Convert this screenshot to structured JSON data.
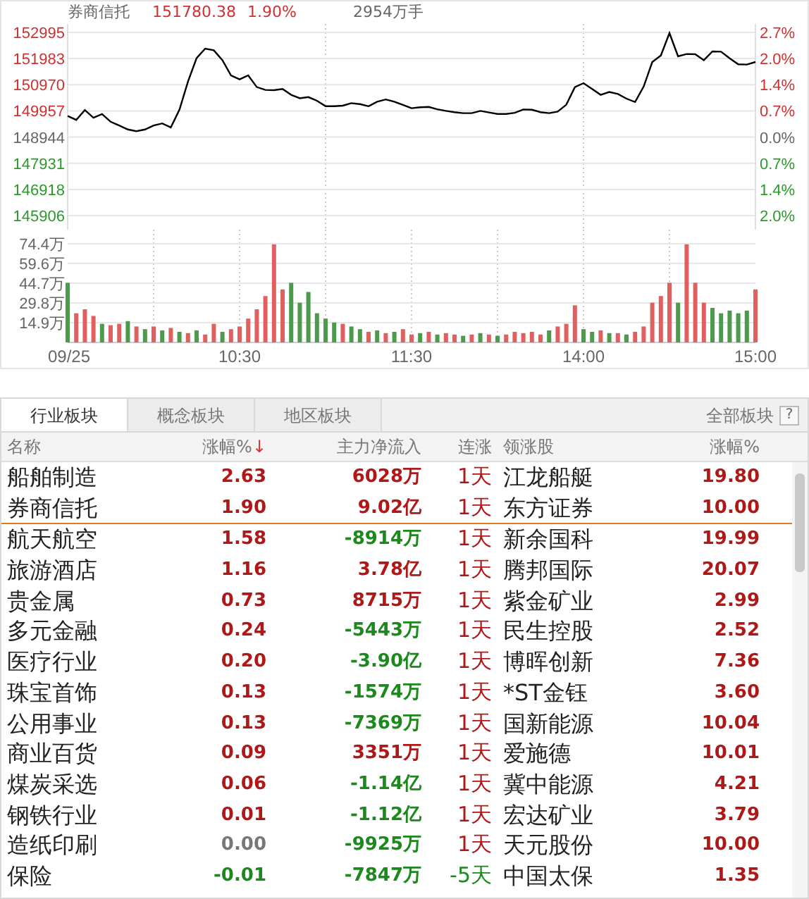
{
  "quote": {
    "name": "券商信托",
    "price": "151780.38",
    "change": "1.90%",
    "volume": "2954万手"
  },
  "price_chart": {
    "right_labels": [
      {
        "label": "2.7%",
        "color": "#d03030"
      },
      {
        "label": "2.0%",
        "color": "#d03030"
      },
      {
        "label": "1.4%",
        "color": "#d03030"
      },
      {
        "label": "0.7%",
        "color": "#d03030"
      },
      {
        "label": "0.0%",
        "color": "#666666"
      },
      {
        "label": "0.7%",
        "color": "#2a9a2a"
      },
      {
        "label": "1.4%",
        "color": "#2a9a2a"
      },
      {
        "label": "2.0%",
        "color": "#2a9a2a"
      }
    ],
    "chart_data": {
      "type": "line",
      "grid": true,
      "ylim": [
        145906,
        152995
      ],
      "yticks": [
        152995,
        151983,
        150970,
        149957,
        148944,
        147931,
        146918,
        145906
      ],
      "categories": [
        null,
        null,
        null,
        null,
        null,
        null,
        null,
        null,
        null,
        null,
        null,
        null,
        null,
        null,
        null,
        null,
        null,
        null,
        null,
        null,
        null,
        null,
        null,
        null,
        null,
        null,
        null,
        null,
        null,
        null,
        null,
        null,
        null,
        null,
        null,
        null,
        null,
        null,
        null,
        null,
        null,
        null,
        null,
        null,
        null,
        null,
        null,
        null,
        null,
        null,
        null,
        null,
        null,
        null,
        null,
        null,
        null,
        null,
        null,
        null,
        null,
        null,
        null,
        null,
        null,
        null,
        null,
        null,
        null,
        null,
        null,
        null,
        null,
        null,
        null,
        null,
        null,
        null,
        null,
        null,
        null
      ],
      "series": [
        {
          "color": "#000000",
          "values": [
            149760,
            149610,
            149990,
            149690,
            149840,
            149540,
            149390,
            149240,
            149170,
            149240,
            149390,
            149470,
            149320,
            150000,
            151100,
            152000,
            152370,
            152300,
            151920,
            151330,
            151180,
            151330,
            150880,
            150770,
            150760,
            150810,
            150580,
            150450,
            150490,
            150350,
            150140,
            150140,
            150160,
            150260,
            150220,
            150140,
            150310,
            150400,
            150310,
            150190,
            150060,
            150100,
            150110,
            150020,
            149960,
            149910,
            149870,
            149870,
            149960,
            149900,
            149840,
            149840,
            149880,
            150010,
            150000,
            149910,
            149870,
            149930,
            150200,
            150880,
            151030,
            150810,
            150580,
            150690,
            150610,
            150430,
            150300,
            150900,
            151850,
            152100,
            152970,
            152070,
            152160,
            152150,
            151920,
            152260,
            152250,
            151990,
            151760,
            151750,
            151850
          ]
        }
      ]
    }
  },
  "volume_chart": {
    "chart_data": {
      "type": "bar",
      "grid": true,
      "ylim": [
        0,
        74.4
      ],
      "yticks": [
        {
          "value": 74.4,
          "label": "74.4万"
        },
        {
          "value": 59.6,
          "label": "59.6万"
        },
        {
          "value": 44.7,
          "label": "44.7万"
        },
        {
          "value": 29.8,
          "label": "29.8万"
        },
        {
          "value": 14.9,
          "label": "14.9万"
        }
      ],
      "categories": [
        "09/25",
        null,
        null,
        null,
        null,
        null,
        null,
        null,
        null,
        null,
        null,
        null,
        null,
        null,
        null,
        null,
        null,
        null,
        null,
        null,
        "10:30",
        null,
        null,
        null,
        null,
        null,
        null,
        null,
        null,
        null,
        null,
        null,
        null,
        null,
        null,
        null,
        null,
        null,
        null,
        null,
        "11:30",
        null,
        null,
        null,
        null,
        null,
        null,
        null,
        null,
        null,
        null,
        null,
        null,
        null,
        null,
        null,
        null,
        null,
        null,
        null,
        "14:00",
        null,
        null,
        null,
        null,
        null,
        null,
        null,
        null,
        null,
        null,
        null,
        null,
        null,
        null,
        null,
        null,
        null,
        null,
        null,
        "15:00"
      ],
      "series": [
        {
          "color": "#e06060",
          "values": [
            null,
            22,
            25,
            20,
            null,
            13,
            14,
            null,
            12,
            null,
            12,
            null,
            11,
            null,
            7,
            null,
            6,
            14,
            null,
            10,
            12,
            18,
            25,
            35,
            74,
            40,
            null,
            null,
            null,
            null,
            null,
            null,
            14,
            null,
            null,
            8,
            null,
            7,
            null,
            10,
            6,
            null,
            8,
            null,
            7,
            6,
            null,
            6,
            null,
            6,
            null,
            6,
            8,
            7,
            8,
            6,
            null,
            12,
            14,
            28,
            null,
            null,
            9,
            null,
            7,
            null,
            8,
            12,
            30,
            35,
            45,
            null,
            74,
            45,
            30,
            null,
            null,
            null,
            null,
            null,
            40
          ]
        },
        {
          "color": "#4c9a4c",
          "values": [
            45,
            null,
            null,
            null,
            14,
            null,
            null,
            16,
            null,
            10,
            null,
            9,
            null,
            8,
            null,
            9,
            null,
            null,
            8,
            null,
            null,
            null,
            null,
            null,
            null,
            null,
            45,
            30,
            38,
            22,
            18,
            15,
            null,
            12,
            10,
            null,
            9,
            null,
            8,
            null,
            null,
            7,
            null,
            6,
            null,
            null,
            5,
            null,
            7,
            null,
            5,
            null,
            null,
            null,
            null,
            null,
            9,
            null,
            null,
            null,
            10,
            8,
            null,
            7,
            null,
            6,
            null,
            null,
            null,
            null,
            null,
            30,
            null,
            null,
            null,
            26,
            22,
            24,
            22,
            24,
            null
          ]
        }
      ]
    }
  },
  "tabs": [
    {
      "label": "行业板块",
      "selected": true
    },
    {
      "label": "概念板块",
      "selected": false
    },
    {
      "label": "地区板块",
      "selected": false
    }
  ],
  "all_sectors": {
    "label": "全部板块",
    "help": "?"
  },
  "columns": [
    {
      "label": "名称"
    },
    {
      "label": "涨幅%",
      "sort_mark": "↓"
    },
    {
      "label": "主力净流入"
    },
    {
      "label": "连涨"
    },
    {
      "label": "领涨股"
    },
    {
      "label": "涨幅%"
    }
  ],
  "rows": [
    {
      "name": "船舶制造",
      "change": {
        "text": "2.63",
        "color": "#b01818"
      },
      "flow": {
        "text": "6028万",
        "color": "#b01818"
      },
      "streak": {
        "text": "1天",
        "color": "#b01818"
      },
      "leader": "江龙船艇",
      "leader_change": "19.80",
      "pinned": true
    },
    {
      "name": "券商信托",
      "change": {
        "text": "1.90",
        "color": "#b01818"
      },
      "flow": {
        "text": "9.02亿",
        "color": "#b01818"
      },
      "streak": {
        "text": "1天",
        "color": "#b01818"
      },
      "leader": "东方证券",
      "leader_change": "10.00",
      "pinned": true
    },
    {
      "name": "航天航空",
      "change": {
        "text": "1.58",
        "color": "#b01818"
      },
      "flow": {
        "text": "-8914万",
        "color": "#1a8a1a"
      },
      "streak": {
        "text": "1天",
        "color": "#b01818"
      },
      "leader": "新余国科",
      "leader_change": "19.99",
      "pinned": false
    },
    {
      "name": "旅游酒店",
      "change": {
        "text": "1.16",
        "color": "#b01818"
      },
      "flow": {
        "text": "3.78亿",
        "color": "#b01818"
      },
      "streak": {
        "text": "1天",
        "color": "#b01818"
      },
      "leader": "腾邦国际",
      "leader_change": "20.07",
      "pinned": false
    },
    {
      "name": "贵金属",
      "change": {
        "text": "0.73",
        "color": "#b01818"
      },
      "flow": {
        "text": "8715万",
        "color": "#b01818"
      },
      "streak": {
        "text": "1天",
        "color": "#b01818"
      },
      "leader": "紫金矿业",
      "leader_change": "2.99",
      "pinned": false
    },
    {
      "name": "多元金融",
      "change": {
        "text": "0.24",
        "color": "#b01818"
      },
      "flow": {
        "text": "-5443万",
        "color": "#1a8a1a"
      },
      "streak": {
        "text": "1天",
        "color": "#b01818"
      },
      "leader": "民生控股",
      "leader_change": "2.52",
      "pinned": false
    },
    {
      "name": "医疗行业",
      "change": {
        "text": "0.20",
        "color": "#b01818"
      },
      "flow": {
        "text": "-3.90亿",
        "color": "#1a8a1a"
      },
      "streak": {
        "text": "1天",
        "color": "#b01818"
      },
      "leader": "博晖创新",
      "leader_change": "7.36",
      "pinned": false
    },
    {
      "name": "珠宝首饰",
      "change": {
        "text": "0.13",
        "color": "#b01818"
      },
      "flow": {
        "text": "-1574万",
        "color": "#1a8a1a"
      },
      "streak": {
        "text": "1天",
        "color": "#b01818"
      },
      "leader": "*ST金钰",
      "leader_change": "3.60",
      "pinned": false
    },
    {
      "name": "公用事业",
      "change": {
        "text": "0.13",
        "color": "#b01818"
      },
      "flow": {
        "text": "-7369万",
        "color": "#1a8a1a"
      },
      "streak": {
        "text": "1天",
        "color": "#b01818"
      },
      "leader": "国新能源",
      "leader_change": "10.04",
      "pinned": false
    },
    {
      "name": "商业百货",
      "change": {
        "text": "0.09",
        "color": "#b01818"
      },
      "flow": {
        "text": "3351万",
        "color": "#b01818"
      },
      "streak": {
        "text": "1天",
        "color": "#b01818"
      },
      "leader": "爱施德",
      "leader_change": "10.01",
      "pinned": false
    },
    {
      "name": "煤炭采选",
      "change": {
        "text": "0.06",
        "color": "#b01818"
      },
      "flow": {
        "text": "-1.14亿",
        "color": "#1a8a1a"
      },
      "streak": {
        "text": "1天",
        "color": "#b01818"
      },
      "leader": "冀中能源",
      "leader_change": "4.21",
      "pinned": false
    },
    {
      "name": "钢铁行业",
      "change": {
        "text": "0.01",
        "color": "#b01818"
      },
      "flow": {
        "text": "-1.12亿",
        "color": "#1a8a1a"
      },
      "streak": {
        "text": "1天",
        "color": "#b01818"
      },
      "leader": "宏达矿业",
      "leader_change": "3.79",
      "pinned": false
    },
    {
      "name": "造纸印刷",
      "change": {
        "text": "0.00",
        "color": "#777777"
      },
      "flow": {
        "text": "-9925万",
        "color": "#1a8a1a"
      },
      "streak": {
        "text": "1天",
        "color": "#b01818"
      },
      "leader": "天元股份",
      "leader_change": "10.00",
      "pinned": false
    },
    {
      "name": "保险",
      "change": {
        "text": "-0.01",
        "color": "#1a8a1a"
      },
      "flow": {
        "text": "-7847万",
        "color": "#1a8a1a"
      },
      "streak": {
        "text": "-5天",
        "color": "#1a8a1a"
      },
      "leader": "中国太保",
      "leader_change": "1.35",
      "pinned": false
    }
  ]
}
